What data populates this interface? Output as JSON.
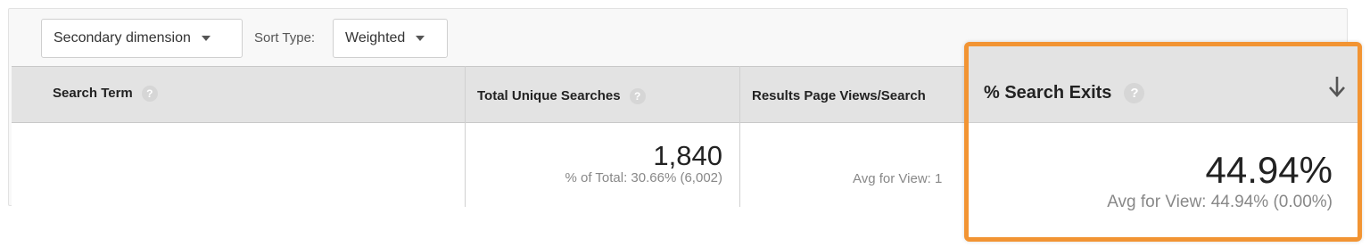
{
  "toolbar": {
    "secondary_dimension_label": "Secondary dimension",
    "sort_type_label": "Sort Type:",
    "sort_type_value": "Weighted"
  },
  "table": {
    "columns": [
      {
        "label": "Search Term"
      },
      {
        "label": "Total Unique Searches"
      },
      {
        "label": "Results Page Views/Search"
      }
    ],
    "totals": {
      "total_unique_searches": "1,840",
      "total_unique_searches_sub": "% of Total: 30.66% (6,002)",
      "results_page_views_sub": "Avg for View: 1"
    }
  },
  "highlight": {
    "column_label": "% Search Exits",
    "value": "44.94%",
    "sub": "Avg for View: 44.94% (0.00%)",
    "accent_color": "#f29433"
  },
  "icons": {
    "help": "help-circle-icon",
    "sort": "arrow-down-icon",
    "caret": "caret-down-icon"
  },
  "help_glyph": "?"
}
